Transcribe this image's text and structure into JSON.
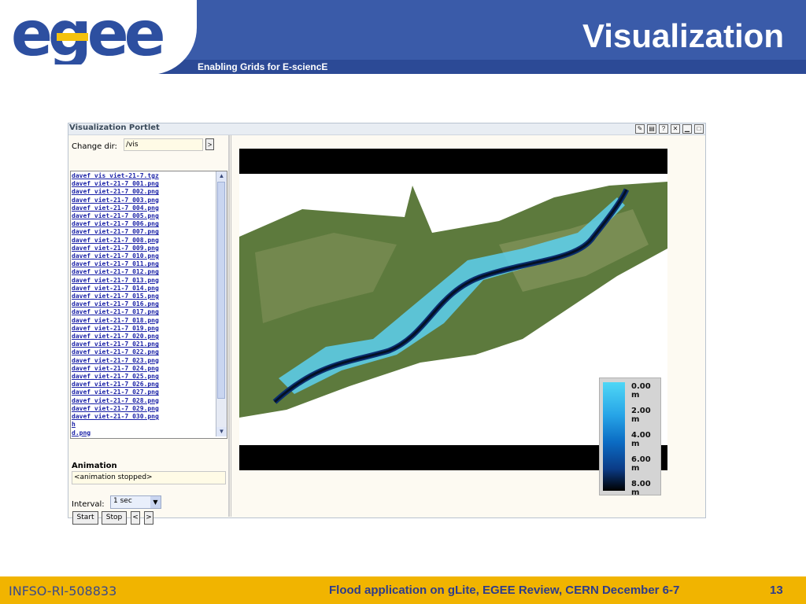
{
  "header": {
    "title": "Visualization",
    "tagline": "Enabling Grids for E-sciencE",
    "logo_text": "egee",
    "colors": {
      "bar": "#3a5ba9",
      "logo_blue": "#2d4fa0",
      "logo_yellow": "#f4c20d"
    }
  },
  "portlet": {
    "title": "Visualization Portlet",
    "change_dir_label": "Change dir:",
    "change_dir_value": "/vis",
    "change_dir_button": ">",
    "files": [
      "davef_vis_viet-21-7.tgz",
      "davef_viet-21-7_001.png",
      "davef_viet-21-7_002.png",
      "davef_viet-21-7_003.png",
      "davef_viet-21-7_004.png",
      "davef_viet-21-7_005.png",
      "davef_viet-21-7_006.png",
      "davef_viet-21-7_007.png",
      "davef_viet-21-7_008.png",
      "davef_viet-21-7_009.png",
      "davef_viet-21-7_010.png",
      "davef_viet-21-7_011.png",
      "davef_viet-21-7_012.png",
      "davef_viet-21-7_013.png",
      "davef_viet-21-7_014.png",
      "davef_viet-21-7_015.png",
      "davef_viet-21-7_016.png",
      "davef_viet-21-7_017.png",
      "davef_viet-21-7_018.png",
      "davef_viet-21-7_019.png",
      "davef_viet-21-7_020.png",
      "davef_viet-21-7_021.png",
      "davef_viet-21-7_022.png",
      "davef_viet-21-7_023.png",
      "davef_viet-21-7_024.png",
      "davef_viet-21-7_025.png",
      "davef_viet-21-7_026.png",
      "davef_viet-21-7_027.png",
      "davef_viet-21-7_028.png",
      "davef_viet-21-7_029.png",
      "davef_viet-21-7_030.png",
      "h",
      "d.png"
    ],
    "animation_label": "Animation",
    "animation_status": "<animation stopped>",
    "interval_label": "Interval:",
    "interval_value": "1 sec",
    "buttons": {
      "start": "Start",
      "stop": "Stop",
      "prev": "<",
      "next": ">"
    },
    "title_icons": [
      "edit-icon",
      "print-icon",
      "help-icon",
      "close-icon",
      "minimize-icon",
      "maximize-icon"
    ]
  },
  "legend": {
    "labels": [
      "0.00 m",
      "2.00 m",
      "4.00 m",
      "6.00 m",
      "8.00 m"
    ]
  },
  "footer": {
    "left": "INFSO-RI-508833",
    "middle": "Flood application on gLite,  EGEE Review, CERN  December 6-7",
    "page": "13",
    "color": "#f1b400"
  }
}
